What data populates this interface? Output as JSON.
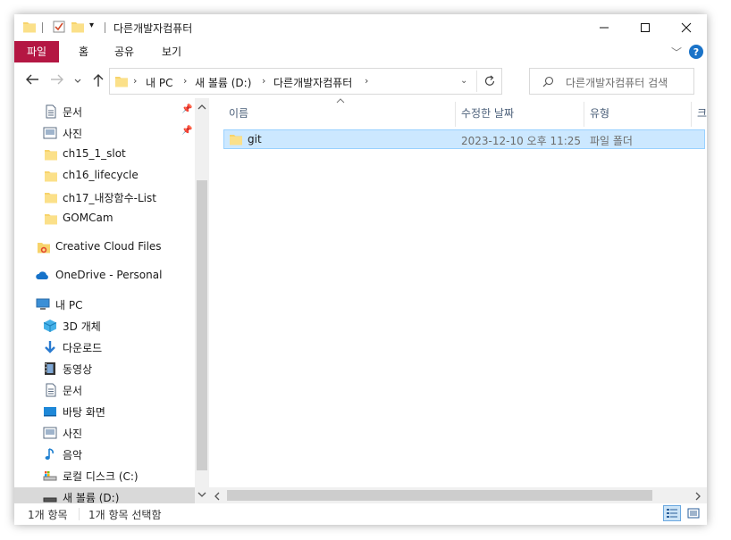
{
  "window": {
    "title": "다른개발자컴퓨터"
  },
  "ribbon": {
    "tabs": [
      {
        "label": "파일"
      },
      {
        "label": "홈"
      },
      {
        "label": "공유"
      },
      {
        "label": "보기"
      }
    ]
  },
  "address": {
    "segments": [
      "내 PC",
      "새 볼륨 (D:)",
      "다른개발자컴퓨터"
    ]
  },
  "search": {
    "placeholder": "다른개발자컴퓨터 검색"
  },
  "sidebar": {
    "items": [
      {
        "label": "문서",
        "icon": "document-icon"
      },
      {
        "label": "사진",
        "icon": "pictures-icon"
      },
      {
        "label": "ch15_1_slot",
        "icon": "folder-icon"
      },
      {
        "label": "ch16_lifecycle",
        "icon": "folder-icon"
      },
      {
        "label": "ch17_내장함수-List",
        "icon": "folder-icon"
      },
      {
        "label": "GOMCam",
        "icon": "folder-icon"
      },
      {
        "label": "Creative Cloud Files",
        "icon": "creative-cloud-icon"
      },
      {
        "label": "OneDrive - Personal",
        "icon": "onedrive-icon"
      },
      {
        "label": "내 PC",
        "icon": "pc-icon"
      },
      {
        "label": "3D 개체",
        "icon": "3d-objects-icon"
      },
      {
        "label": "다운로드",
        "icon": "download-icon"
      },
      {
        "label": "동영상",
        "icon": "video-icon"
      },
      {
        "label": "문서",
        "icon": "document-icon"
      },
      {
        "label": "바탕 화면",
        "icon": "desktop-icon"
      },
      {
        "label": "사진",
        "icon": "pictures-icon"
      },
      {
        "label": "음악",
        "icon": "music-icon"
      },
      {
        "label": "로컬 디스크 (C:)",
        "icon": "local-disk-icon"
      },
      {
        "label": "새 볼륨 (D:)",
        "icon": "drive-icon"
      }
    ]
  },
  "file_list": {
    "columns": [
      "이름",
      "수정한 날짜",
      "유형",
      "크"
    ],
    "rows": [
      {
        "name": "git",
        "modified": "2023-12-10 오후 11:25",
        "type": "파일 폴더"
      }
    ]
  },
  "status_bar": {
    "item_count": "1개 항목",
    "selected": "1개 항목 선택함"
  },
  "colors": {
    "file_tab": "#b41743",
    "selection": "#cce8ff",
    "help": "#1a73c8"
  }
}
